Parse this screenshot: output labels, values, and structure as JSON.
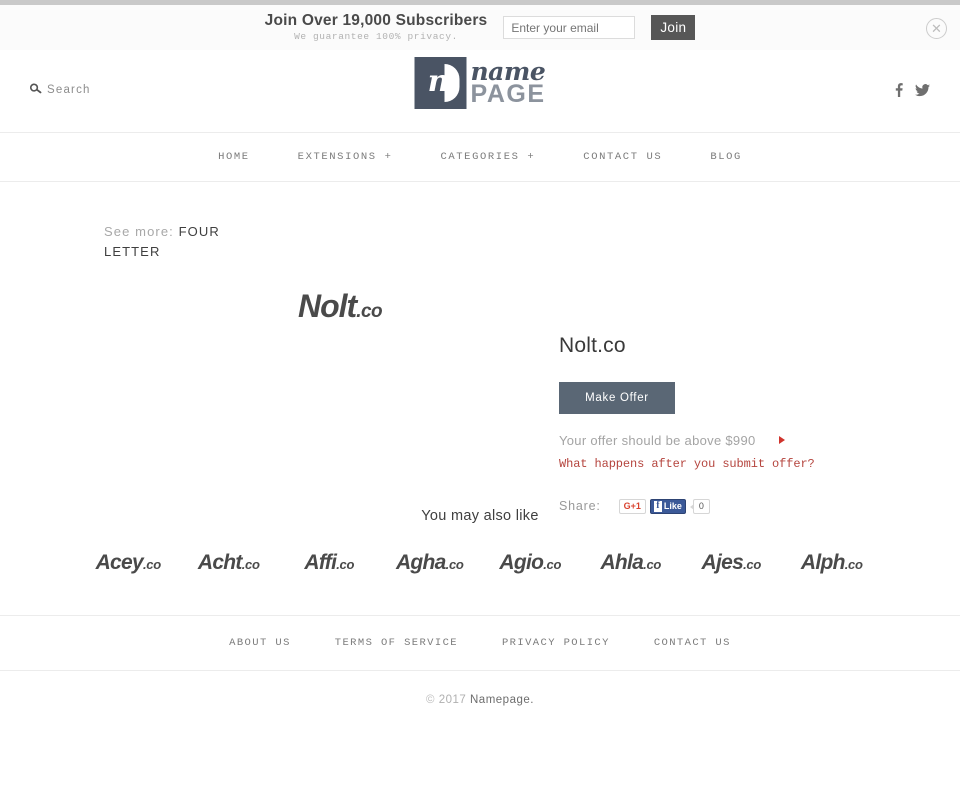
{
  "promo_banner": {
    "title": "Join Over 19,000 Subscribers",
    "subtitle": "We guarantee 100% privacy.",
    "email_placeholder": "Enter your email",
    "email_value": "",
    "join_label": "Join",
    "close_icon": "close-circle-icon",
    "close_glyph": "✕"
  },
  "header": {
    "search_label": "Search",
    "search_icon": "search-icon",
    "search_glyph": "⚲",
    "logo": {
      "mark_letter": "n",
      "word_top": "name",
      "word_bottom": "PAGE",
      "mark_color": "#4a5464",
      "page_color": "#8c939d"
    },
    "social": [
      {
        "name": "facebook-icon",
        "glyph": "f"
      },
      {
        "name": "twitter-icon",
        "glyph": "🐦"
      }
    ]
  },
  "nav": {
    "items": [
      {
        "label": "HOME"
      },
      {
        "label": "EXTENSIONS +"
      },
      {
        "label": "CATEGORIES +"
      },
      {
        "label": "CONTACT US"
      },
      {
        "label": "BLOG"
      }
    ]
  },
  "breadcrumb": {
    "label": "See more:",
    "link": "FOUR LETTER"
  },
  "product": {
    "art_base": "Nolt",
    "art_tld": ".co",
    "title": "Nolt.co",
    "make_offer_label": "Make Offer",
    "offer_note": "Your offer should be above $990",
    "offer_minimum": "$990",
    "offer_help_link": "What happens after you submit offer?",
    "marker_color": "#d0342c",
    "button_color": "#5a6775",
    "share": {
      "label": "Share:",
      "gplus_label": "G+1",
      "fb_letter": "f",
      "fb_like_label": "Like",
      "fb_count": "0"
    }
  },
  "also_like": {
    "title": "You may also like",
    "items": [
      {
        "base": "Acey",
        "tld": ".co"
      },
      {
        "base": "Acht",
        "tld": ".co"
      },
      {
        "base": "Affi",
        "tld": ".co"
      },
      {
        "base": "Agha",
        "tld": ".co"
      },
      {
        "base": "Agio",
        "tld": ".co"
      },
      {
        "base": "Ahla",
        "tld": ".co"
      },
      {
        "base": "Ajes",
        "tld": ".co"
      },
      {
        "base": "Alph",
        "tld": ".co"
      }
    ]
  },
  "footer": {
    "links": [
      {
        "label": "ABOUT US"
      },
      {
        "label": "TERMS OF SERVICE"
      },
      {
        "label": "PRIVACY POLICY"
      },
      {
        "label": "CONTACT US"
      }
    ],
    "copyright_symbol": "©",
    "copyright_year": "2017",
    "copyright_name": "Namepage."
  }
}
